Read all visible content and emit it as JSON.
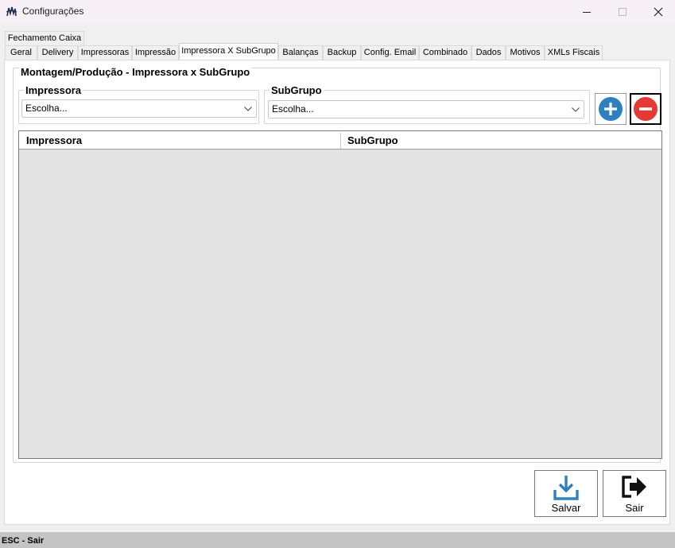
{
  "window": {
    "title": "Configurações",
    "icon": "app-logo-icon",
    "controls": {
      "minimize": "minimize-icon",
      "maximize": "maximize-icon",
      "close": "close-icon"
    }
  },
  "tabs": {
    "row1": [
      {
        "label": "Fechamento Caixa"
      }
    ],
    "row2": [
      {
        "label": "Geral"
      },
      {
        "label": "Delivery"
      },
      {
        "label": "Impressoras"
      },
      {
        "label": "Impressão"
      },
      {
        "label": "Impressora X SubGrupo",
        "active": true
      },
      {
        "label": "Balanças"
      },
      {
        "label": "Backup"
      },
      {
        "label": "Config. Email"
      },
      {
        "label": "Combinado"
      },
      {
        "label": "Dados"
      },
      {
        "label": "Motivos"
      },
      {
        "label": "XMLs Fiscais"
      }
    ]
  },
  "section": {
    "title": "Montagem/Produção - Impressora x SubGrupo",
    "impressora": {
      "label": "Impressora",
      "value": "Escolha..."
    },
    "subgrupo": {
      "label": "SubGrupo",
      "value": "Escolha..."
    },
    "add_icon": "plus-circle-icon",
    "remove_icon": "minus-circle-icon",
    "colors": {
      "add": "#2f7fc1",
      "remove": "#e53935"
    }
  },
  "grid": {
    "columns": [
      "Impressora",
      "SubGrupo"
    ],
    "rows": []
  },
  "actions": {
    "save": {
      "label": "Salvar",
      "icon": "download-tray-icon",
      "color": "#2f7fc1"
    },
    "exit": {
      "label": "Sair",
      "icon": "exit-arrow-icon"
    }
  },
  "status": {
    "text": "ESC - Sair"
  }
}
